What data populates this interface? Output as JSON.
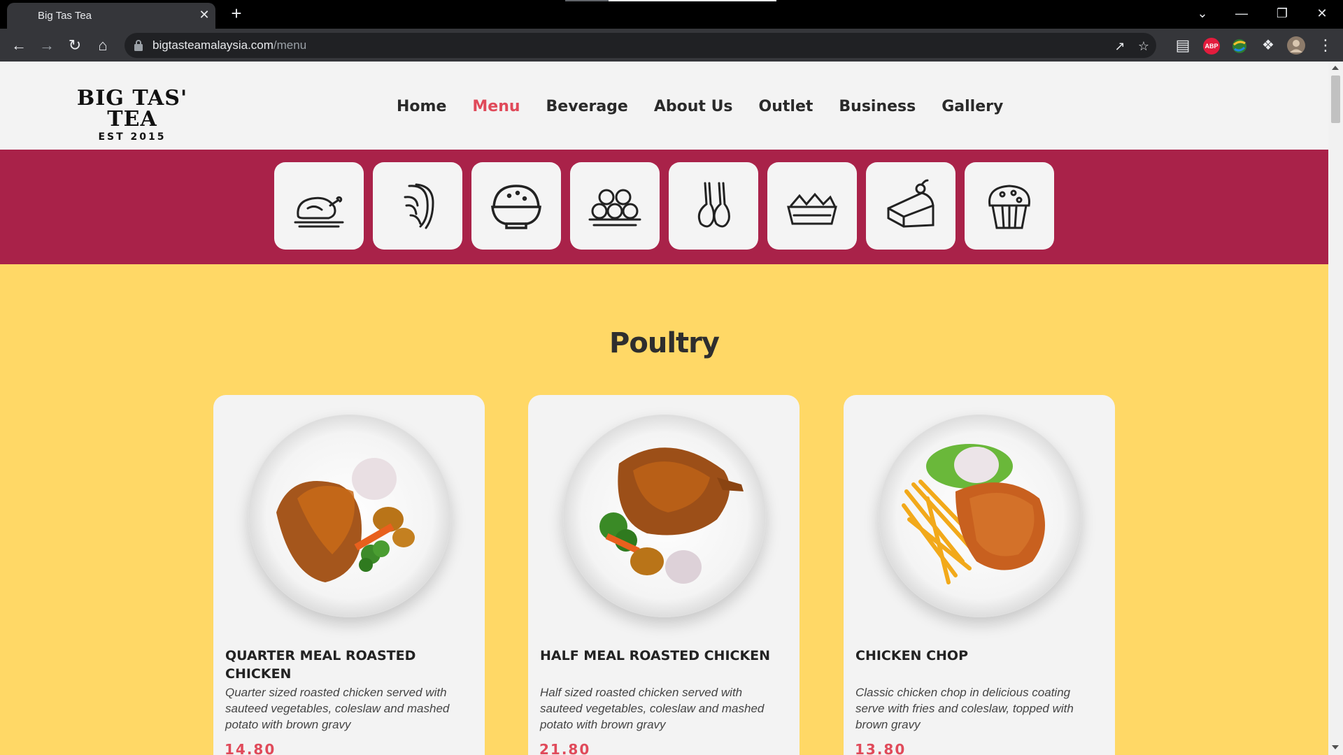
{
  "browser": {
    "tab_title": "Big Tas Tea",
    "tab_close": "✕",
    "new_tab": "+",
    "url_host": "bigtasteamalaysia.com",
    "url_path": "/menu",
    "window_controls": [
      "⌄",
      "—",
      "❐",
      "✕"
    ],
    "extensions": [
      {
        "name": "adblock-plus-icon",
        "label": "ABP",
        "color": "#e31c3d"
      },
      {
        "name": "puzzle-icon",
        "label": "",
        "color": "#35363a"
      }
    ]
  },
  "site": {
    "logo_main": "BIG TAS' TEA",
    "logo_sub": "EST 2015",
    "nav": [
      "Home",
      "Menu",
      "Beverage",
      "About Us",
      "Outlet",
      "Business",
      "Gallery"
    ],
    "active_nav": "Menu",
    "accent_color": "#e04a5a",
    "band_color": "#a92249",
    "content_color": "#ffd866"
  },
  "categories": [
    {
      "icon": "roast-chicken-icon"
    },
    {
      "icon": "pasta-icon"
    },
    {
      "icon": "rice-bowl-icon"
    },
    {
      "icon": "dim-sum-icon"
    },
    {
      "icon": "lamb-chop-icon"
    },
    {
      "icon": "snack-basket-icon"
    },
    {
      "icon": "cake-slice-icon"
    },
    {
      "icon": "muffin-icon"
    }
  ],
  "section": {
    "title": "Poultry"
  },
  "items": [
    {
      "title": "QUARTER MEAL ROASTED CHICKEN",
      "description": "Quarter sized roasted chicken served with sauteed vegetables, coleslaw and mashed potato with brown gravy",
      "price": "14.80"
    },
    {
      "title": "HALF MEAL ROASTED CHICKEN",
      "description": "Half sized roasted chicken served with sauteed vegetables, coleslaw and mashed potato with brown gravy",
      "price": "21.80"
    },
    {
      "title": "CHICKEN CHOP",
      "description": "Classic chicken chop in delicious coating serve with fries and coleslaw, topped with brown gravy",
      "price": "13.80"
    }
  ]
}
